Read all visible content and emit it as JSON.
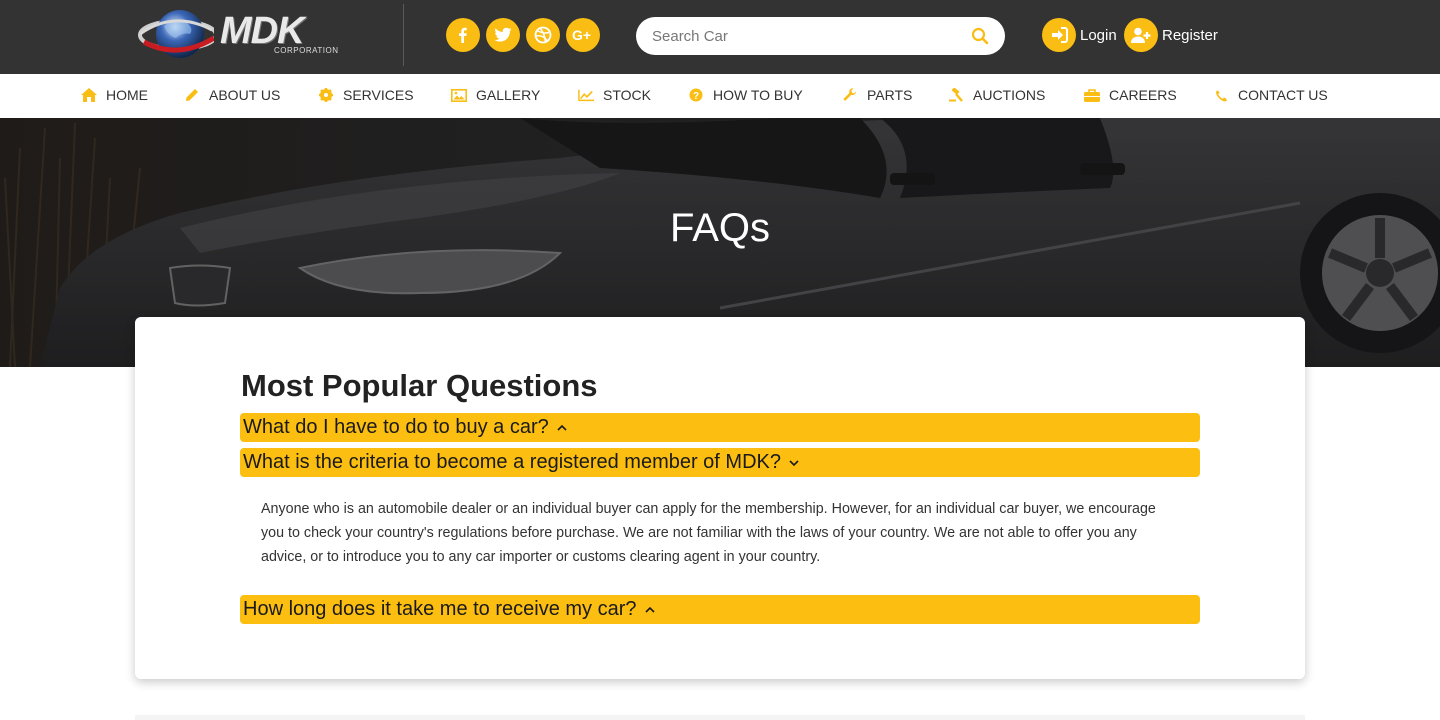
{
  "header": {
    "logo_text": "MDK",
    "logo_subtext": "CORPORATION",
    "social": [
      {
        "icon": "facebook-icon",
        "glyph": "f"
      },
      {
        "icon": "twitter-icon",
        "glyph": "t"
      },
      {
        "icon": "dribbble-icon",
        "glyph": "d"
      },
      {
        "icon": "google-plus-icon",
        "glyph": "G+"
      }
    ],
    "search": {
      "placeholder": "Search Car",
      "value": ""
    },
    "login_label": "Login",
    "register_label": "Register"
  },
  "nav": {
    "items": [
      {
        "label": "HOME",
        "icon": "home-icon"
      },
      {
        "label": "ABOUT US",
        "icon": "pencil-icon"
      },
      {
        "label": "SERVICES",
        "icon": "gear-icon"
      },
      {
        "label": "GALLERY",
        "icon": "image-icon"
      },
      {
        "label": "STOCK",
        "icon": "chart-icon"
      },
      {
        "label": "HOW TO BUY",
        "icon": "question-icon"
      },
      {
        "label": "PARTS",
        "icon": "wrench-icon"
      },
      {
        "label": "AUCTIONS",
        "icon": "gavel-icon"
      },
      {
        "label": "CAREERS",
        "icon": "briefcase-icon"
      },
      {
        "label": "CONTACT US",
        "icon": "phone-icon"
      }
    ]
  },
  "hero": {
    "title": "FAQs"
  },
  "faq": {
    "heading": "Most Popular Questions",
    "items": [
      {
        "question": "What do I have to do to buy a car?",
        "expanded": false
      },
      {
        "question": "What is the criteria to become a registered member of MDK?",
        "expanded": true,
        "answer": "Anyone who is an automobile dealer or an individual buyer can apply for the membership. However, for an individual car buyer, we encourage you to check your country's regulations before purchase. We are not familiar with the laws of your country. We are not able to offer you any advice, or to introduce you to any car importer or customs clearing agent in your country."
      },
      {
        "question": "How long does it take me to receive my car?",
        "expanded": false
      }
    ]
  },
  "colors": {
    "accent": "#fcbe10",
    "header_bg": "#333333",
    "hero_overlay": "#2c2c2e"
  }
}
